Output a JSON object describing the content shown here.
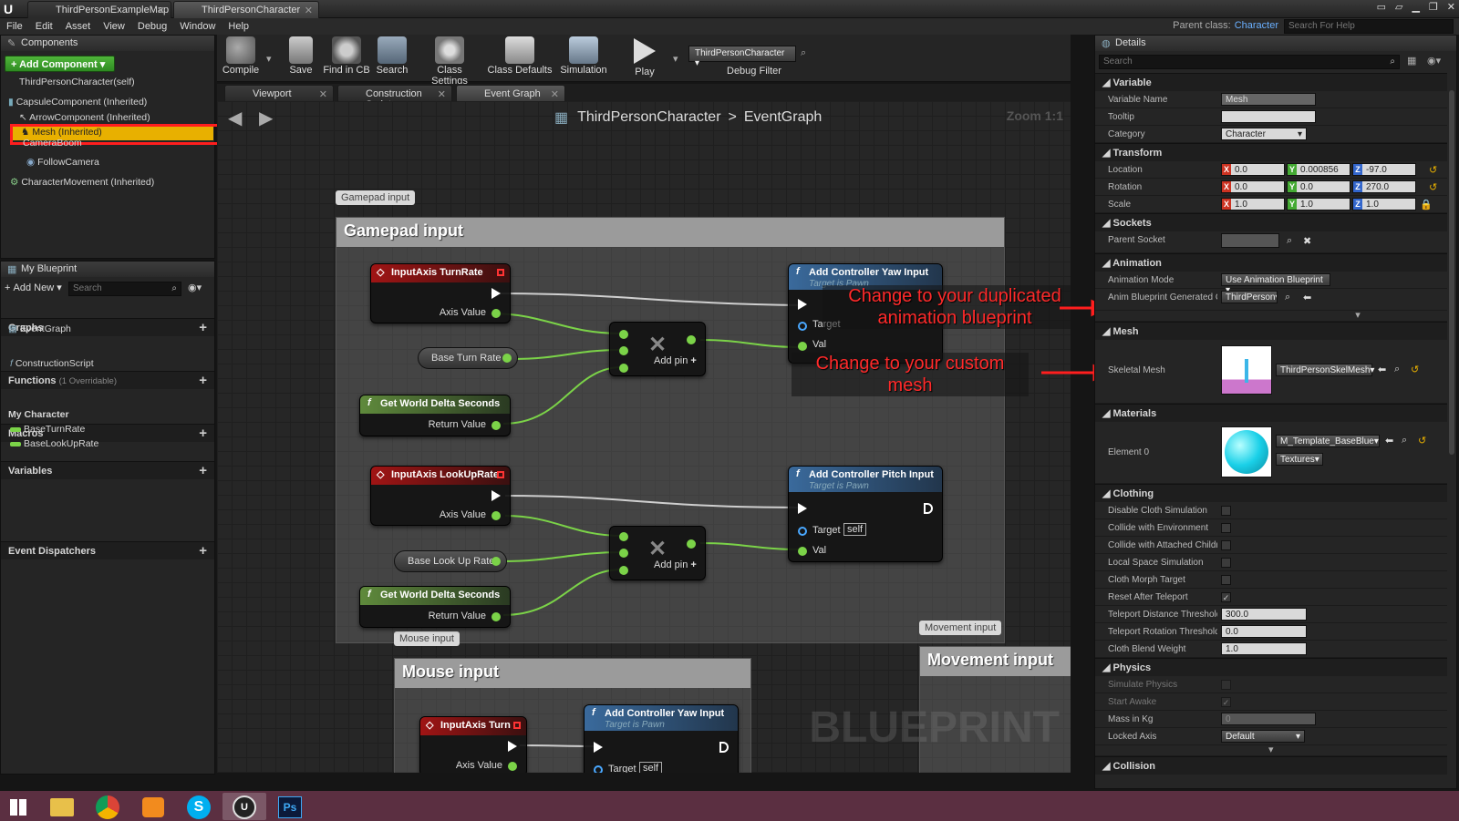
{
  "title_tabs": [
    "ThirdPersonExampleMap",
    "ThirdPersonCharacter"
  ],
  "menu": [
    "File",
    "Edit",
    "Asset",
    "View",
    "Debug",
    "Window",
    "Help"
  ],
  "parent_class_label": "Parent class:",
  "parent_class_value": "Character",
  "help_search_placeholder": "Search For Help",
  "components": {
    "title": "Components",
    "add_button": "+ Add Component",
    "items": [
      "ThirdPersonCharacter(self)",
      "CapsuleComponent (Inherited)",
      "ArrowComponent (Inherited)",
      "Mesh (Inherited)",
      "CameraBoom",
      "FollowCamera",
      "CharacterMovement (Inherited)"
    ]
  },
  "my_blueprint": {
    "title": "My Blueprint",
    "add_new": "Add New",
    "search_placeholder": "Search",
    "graphs": "Graphs",
    "event_graph": "EventGraph",
    "functions": "Functions",
    "overridable": "(1 Overridable)",
    "construction": "ConstructionScript",
    "macros": "Macros",
    "variables": "Variables",
    "my_character": "My Character",
    "var_items": [
      "BaseTurnRate",
      "BaseLookUpRate"
    ],
    "dispatchers": "Event Dispatchers"
  },
  "toolbar": {
    "buttons": [
      "Compile",
      "Save",
      "Find in CB",
      "Search",
      "Class Settings",
      "Class Defaults",
      "Simulation",
      "Play"
    ],
    "debug_object": "ThirdPersonCharacter",
    "debug_filter": "Debug Filter"
  },
  "editor_tabs": [
    "Viewport",
    "Construction Script",
    "Event Graph"
  ],
  "breadcrumb": {
    "class": "ThirdPersonCharacter",
    "sep": ">",
    "graph": "EventGraph"
  },
  "zoom": "Zoom 1:1",
  "watermark": "BLUEPRINT",
  "graph": {
    "comments": [
      "Gamepad input",
      "Mouse input",
      "Movement input"
    ],
    "nodes": {
      "turn_rate": "InputAxis TurnRate",
      "lookup_rate": "InputAxis LookUpRate",
      "turn": "InputAxis Turn",
      "axis_value": "Axis Value",
      "base_turn": "Base Turn Rate",
      "base_lookup": "Base Look Up Rate",
      "world_delta": "Get World Delta Seconds",
      "return_value": "Return Value",
      "add_pin": "Add pin",
      "yaw": "Add Controller Yaw Input",
      "pitch": "Add Controller Pitch Input",
      "target_is_pawn": "Target is Pawn",
      "target": "Target",
      "self": "self",
      "val": "Val"
    }
  },
  "annotations": [
    "Change to your duplicated animation blueprint",
    "Change to your custom mesh"
  ],
  "details": {
    "title": "Details",
    "search_placeholder": "Search",
    "sections": {
      "variable": "Variable",
      "transform": "Transform",
      "sockets": "Sockets",
      "animation": "Animation",
      "mesh": "Mesh",
      "materials": "Materials",
      "clothing": "Clothing",
      "physics": "Physics",
      "collision": "Collision"
    },
    "variable_name_label": "Variable Name",
    "variable_name": "Mesh",
    "tooltip_label": "Tooltip",
    "category_label": "Category",
    "category": "Character",
    "location_label": "Location",
    "location": [
      "0.0",
      "0.000856",
      "-97.0"
    ],
    "rotation_label": "Rotation",
    "rotation": [
      "0.0",
      "0.0",
      "270.0"
    ],
    "scale_label": "Scale",
    "scale": [
      "1.0",
      "1.0",
      "1.0"
    ],
    "parent_socket_label": "Parent Socket",
    "anim_mode_label": "Animation Mode",
    "anim_mode": "Use Animation Blueprint",
    "anim_class_label": "Anim Blueprint Generated Cl",
    "anim_class": "ThirdPerson",
    "skeletal_mesh_label": "Skeletal Mesh",
    "skeletal_mesh": "ThirdPersonSkelMesh",
    "element0_label": "Element 0",
    "material": "M_Template_BaseBlue",
    "textures": "Textures",
    "clothing_rows": [
      {
        "label": "Disable Cloth Simulation",
        "checked": false
      },
      {
        "label": "Collide with Environment",
        "checked": false
      },
      {
        "label": "Collide with Attached Childre",
        "checked": false
      },
      {
        "label": "Local Space Simulation",
        "checked": false
      },
      {
        "label": "Cloth Morph Target",
        "checked": false
      },
      {
        "label": "Reset After Teleport",
        "checked": true
      }
    ],
    "teleport_dist_label": "Teleport Distance Threshold",
    "teleport_dist": "300.0",
    "teleport_rot_label": "Teleport Rotation Threshold",
    "teleport_rot": "0.0",
    "cloth_blend_label": "Cloth Blend Weight",
    "cloth_blend": "1.0",
    "simulate_label": "Simulate Physics",
    "start_awake_label": "Start Awake",
    "mass_label": "Mass in Kg",
    "mass": "0",
    "locked_axis_label": "Locked Axis",
    "locked_axis": "Default"
  },
  "colors": {
    "accent": "#e8b000",
    "highlight_box": "#ff1e1e",
    "event_node": "#a01414",
    "function_node": "#3a6a9c",
    "float_pin": "#7bd348",
    "taskbar": "#5b2f41"
  }
}
